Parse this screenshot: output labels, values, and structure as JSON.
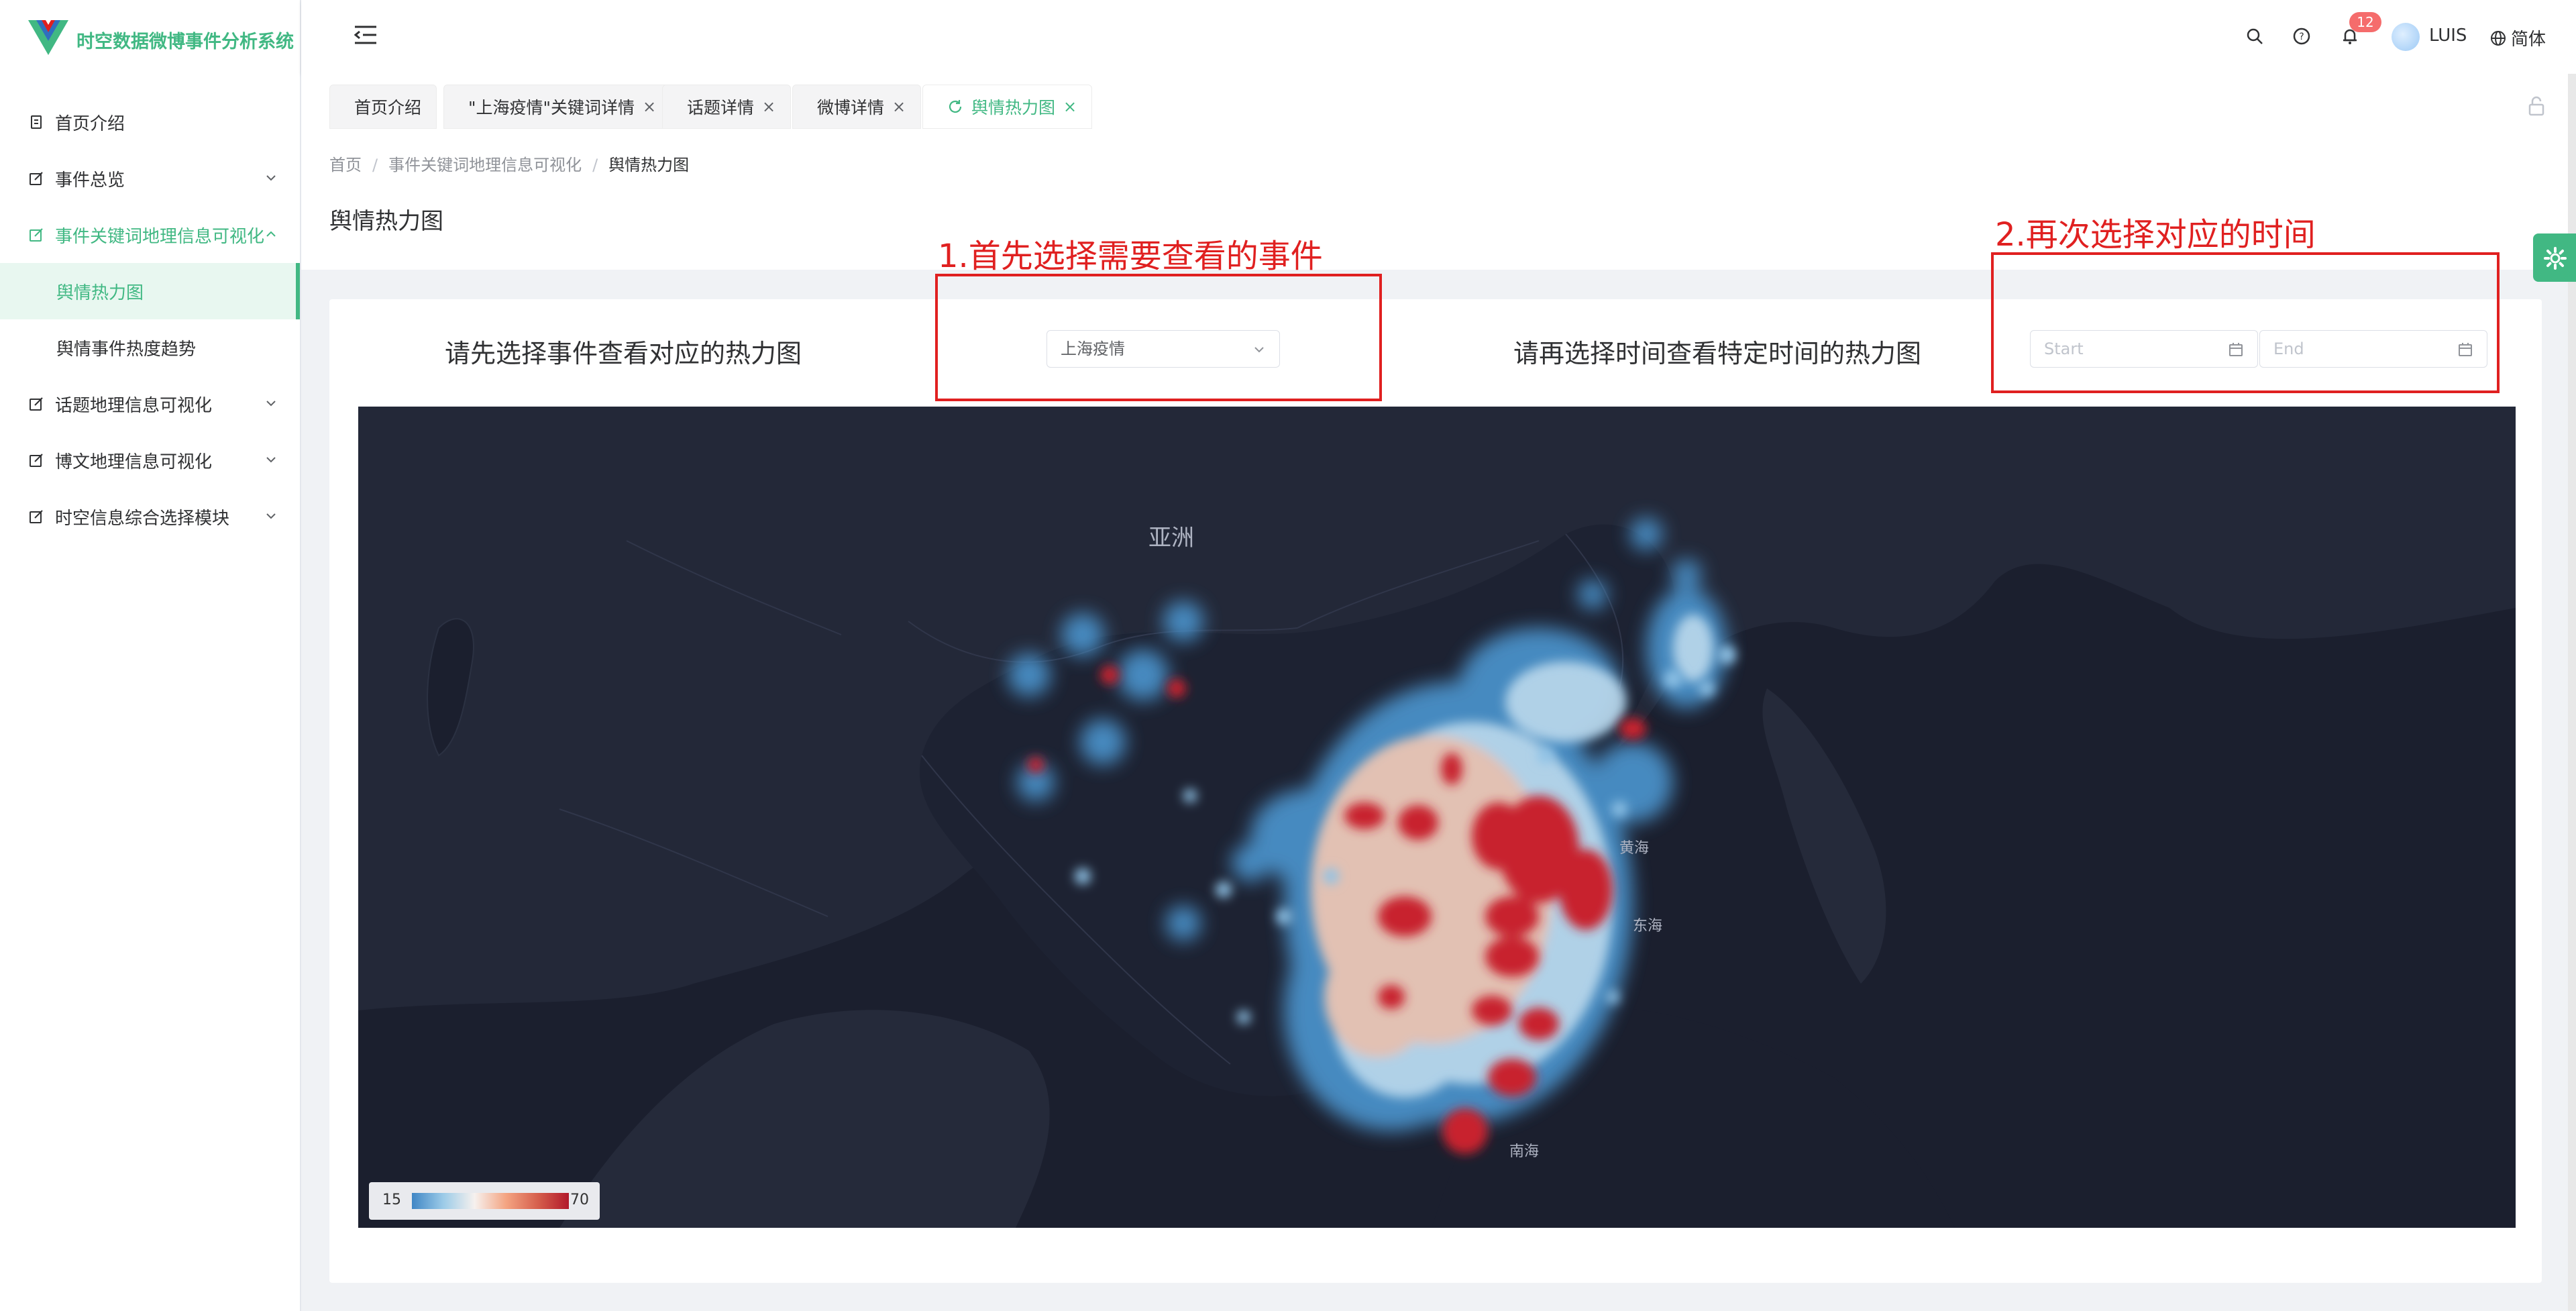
{
  "app": {
    "title": "时空数据微博事件分析系统",
    "brand_color": "#41b883",
    "logo_icon": "vue-logo"
  },
  "sidebar": {
    "items": [
      {
        "label": "首页介绍",
        "icon": "document-icon"
      },
      {
        "label": "事件总览",
        "icon": "edit-icon",
        "has_children": true
      },
      {
        "label": "事件关键词地理信息可视化",
        "icon": "edit-icon",
        "has_children": true,
        "expanded": true,
        "children": [
          {
            "label": "舆情热力图",
            "active": true
          },
          {
            "label": "舆情事件热度趋势"
          }
        ]
      },
      {
        "label": "话题地理信息可视化",
        "icon": "edit-icon",
        "has_children": true
      },
      {
        "label": "博文地理信息可视化",
        "icon": "edit-icon",
        "has_children": true
      },
      {
        "label": "时空信息综合选择模块",
        "icon": "edit-icon",
        "has_children": true
      }
    ]
  },
  "header": {
    "notifications_count": "12",
    "username": "LUIS",
    "language": "简体"
  },
  "tabs": [
    {
      "label": "首页介绍",
      "closable": false
    },
    {
      "label": "\"上海疫情\"关键词详情",
      "closable": true
    },
    {
      "label": "话题详情",
      "closable": true
    },
    {
      "label": "微博详情",
      "closable": true
    },
    {
      "label": "舆情热力图",
      "closable": true,
      "active": true
    }
  ],
  "breadcrumb": [
    "首页",
    "事件关键词地理信息可视化",
    "舆情热力图"
  ],
  "page_title": "舆情热力图",
  "filters": {
    "event_label": "请先选择事件查看对应的热力图",
    "event_value": "上海疫情",
    "time_label": "请再选择时间查看特定时间的热力图",
    "start_placeholder": "Start",
    "end_placeholder": "End"
  },
  "map": {
    "labels": {
      "asia": "亚洲",
      "yellow_sea": "黄海",
      "east_sea": "东海",
      "south_sea": "南海"
    },
    "legend": {
      "min": "15",
      "max": "70"
    },
    "background": "#1b1f2e"
  },
  "annotations": {
    "step1": "1.首先选择需要查看的事件",
    "step2": "2.再次选择对应的时间",
    "color": "#e02020"
  }
}
